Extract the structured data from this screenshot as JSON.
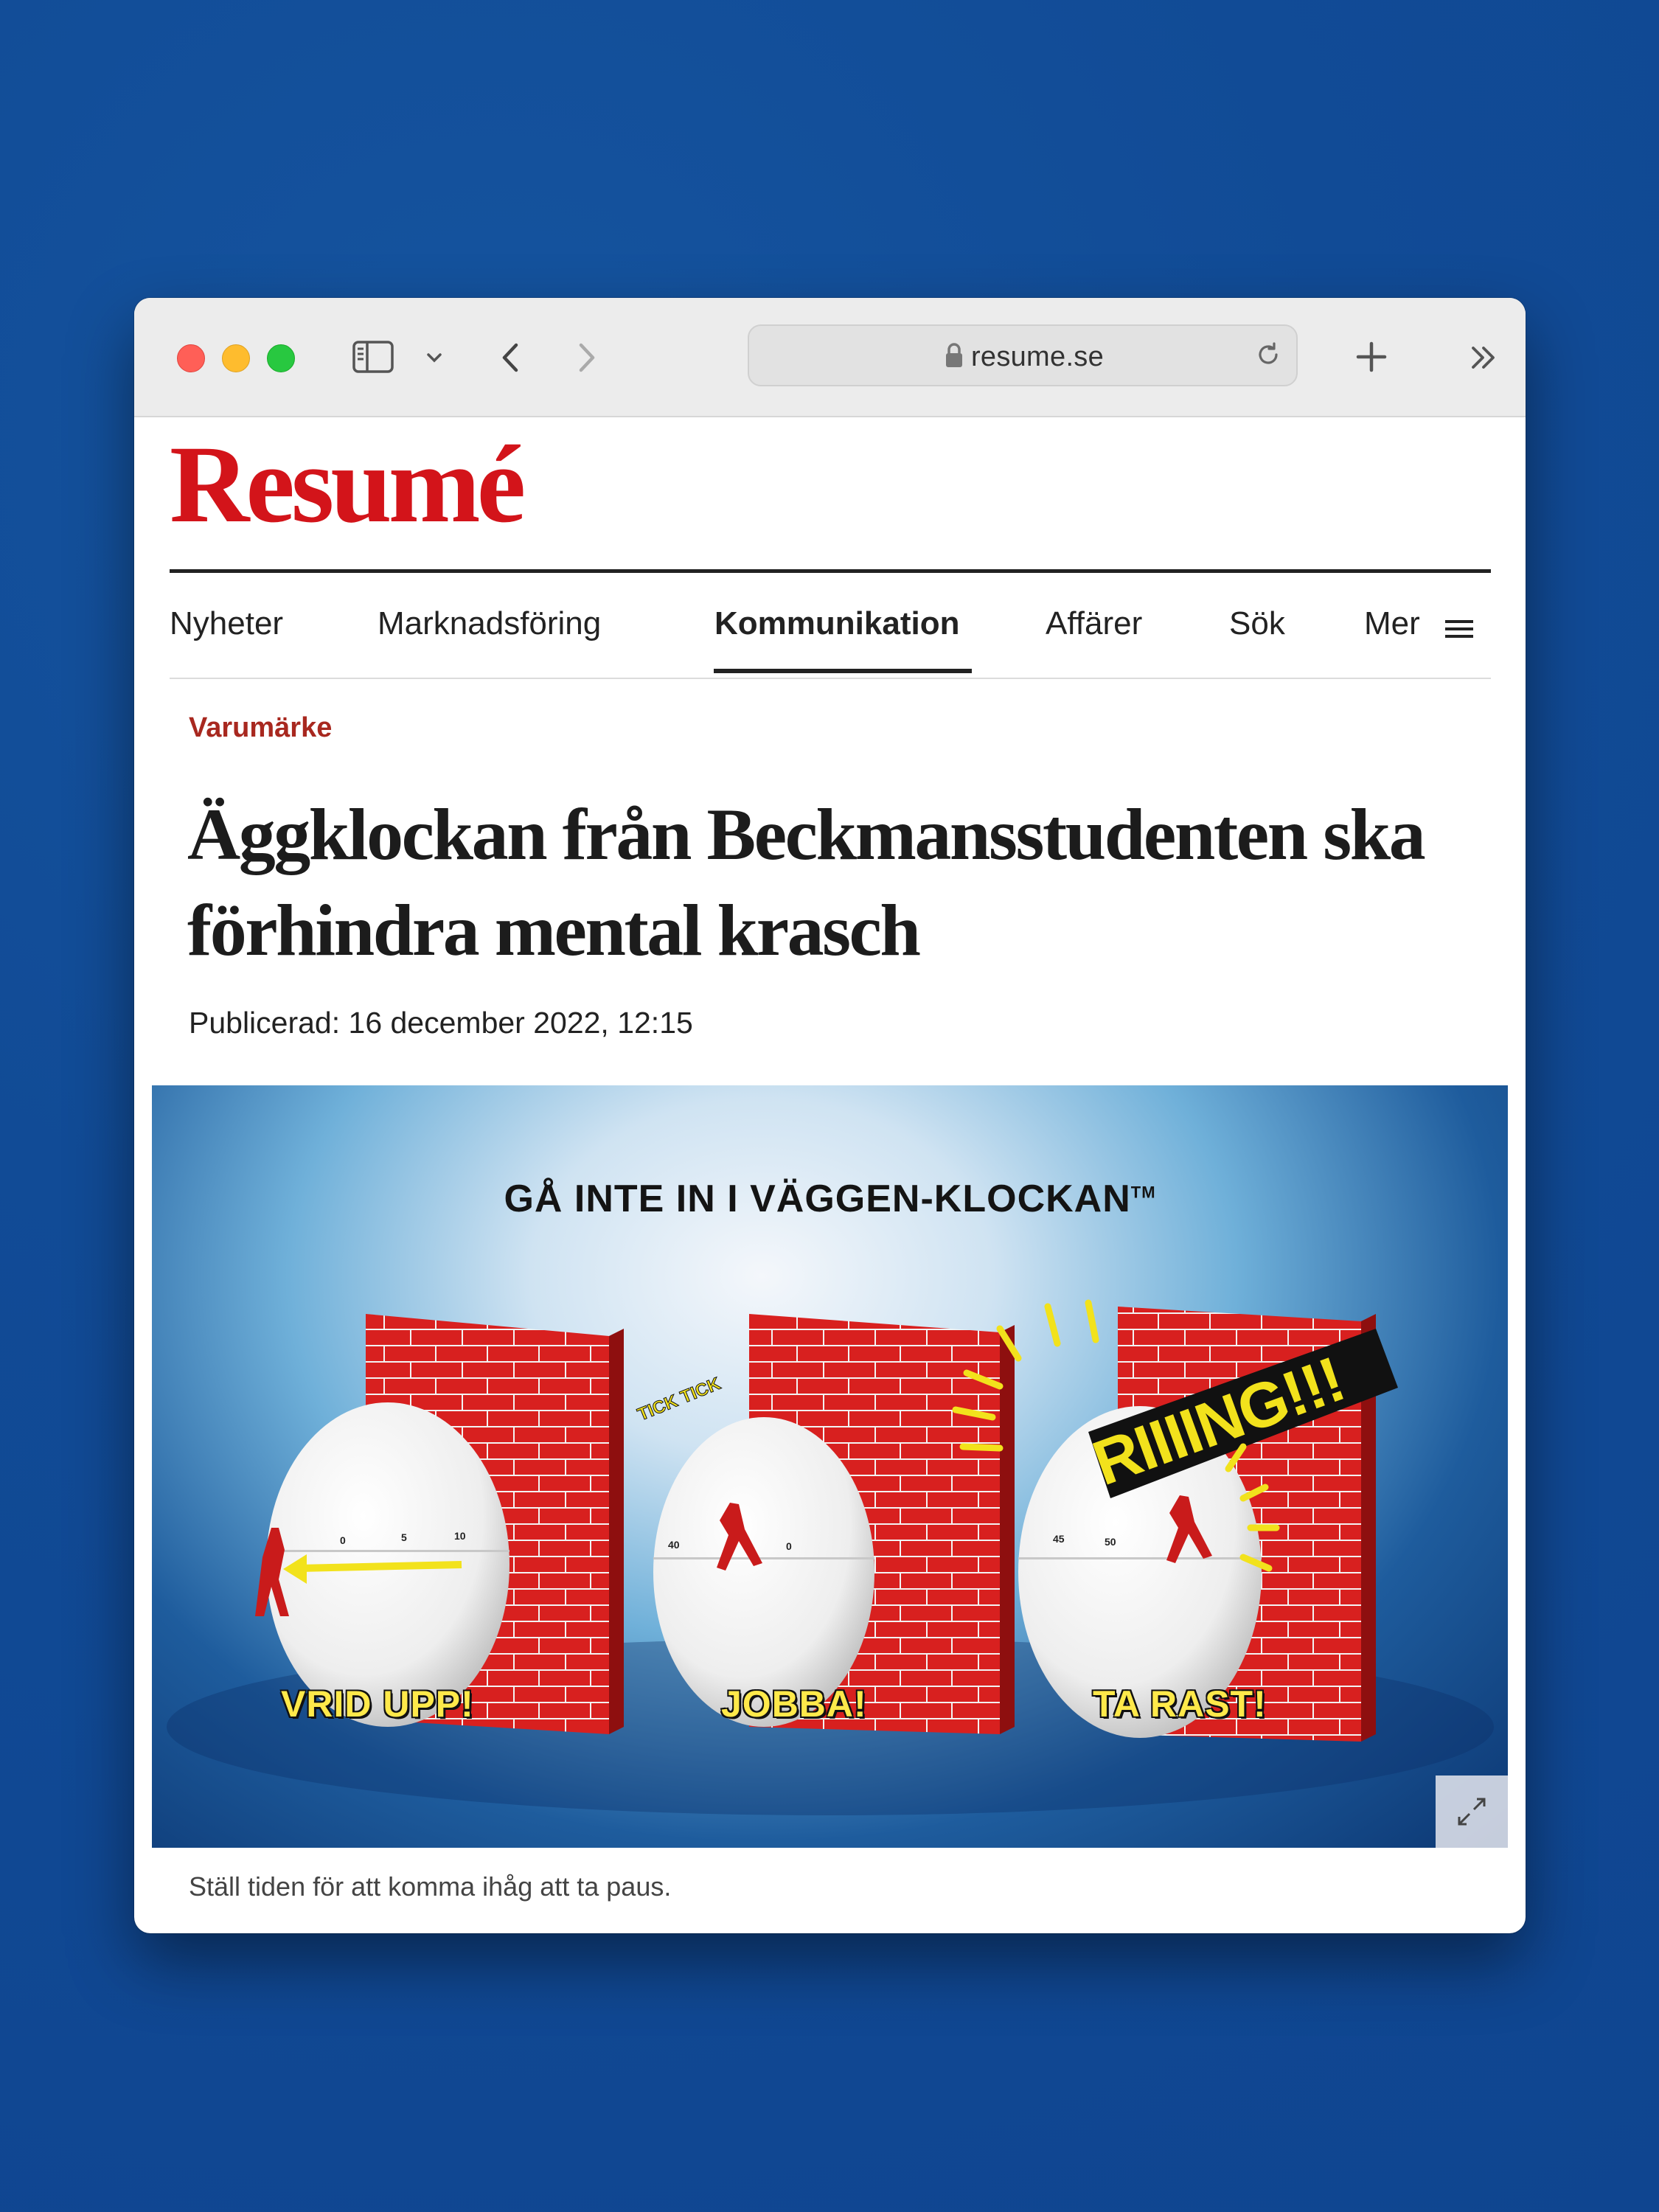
{
  "browser": {
    "url": "resume.se",
    "icons": [
      "sidebar-icon",
      "chevron-down-icon",
      "back-icon",
      "forward-icon",
      "lock-icon",
      "reload-icon",
      "plus-icon",
      "more-icon"
    ]
  },
  "site": {
    "logo": "Resumé",
    "brand_color": "#d3141a"
  },
  "nav": {
    "items": [
      "Nyheter",
      "Marknadsföring",
      "Kommunikation",
      "Affärer",
      "Sök"
    ],
    "active": "Kommunikation",
    "more_label": "Mer"
  },
  "article": {
    "kicker": "Varumärke",
    "title": "Äggklockan från Beckmansstudenten ska förhindra mental krasch",
    "published": "Publicerad: 16 december 2022, 12:15",
    "caption": "Ställ tiden för att komma ihåg att ta paus."
  },
  "image": {
    "title": "GÅ INTE IN I VÄGGEN-KLOCKAN",
    "trademark": "TM",
    "tick": "TICK TICK",
    "ring": "RIIIING!!!",
    "labels": [
      "VRID UPP!",
      "JOBBA!",
      "TA RAST!"
    ],
    "dial1": [
      "0",
      "5",
      "10"
    ],
    "dial2": [
      "40",
      "0"
    ],
    "dial3": [
      "45",
      "50"
    ]
  }
}
